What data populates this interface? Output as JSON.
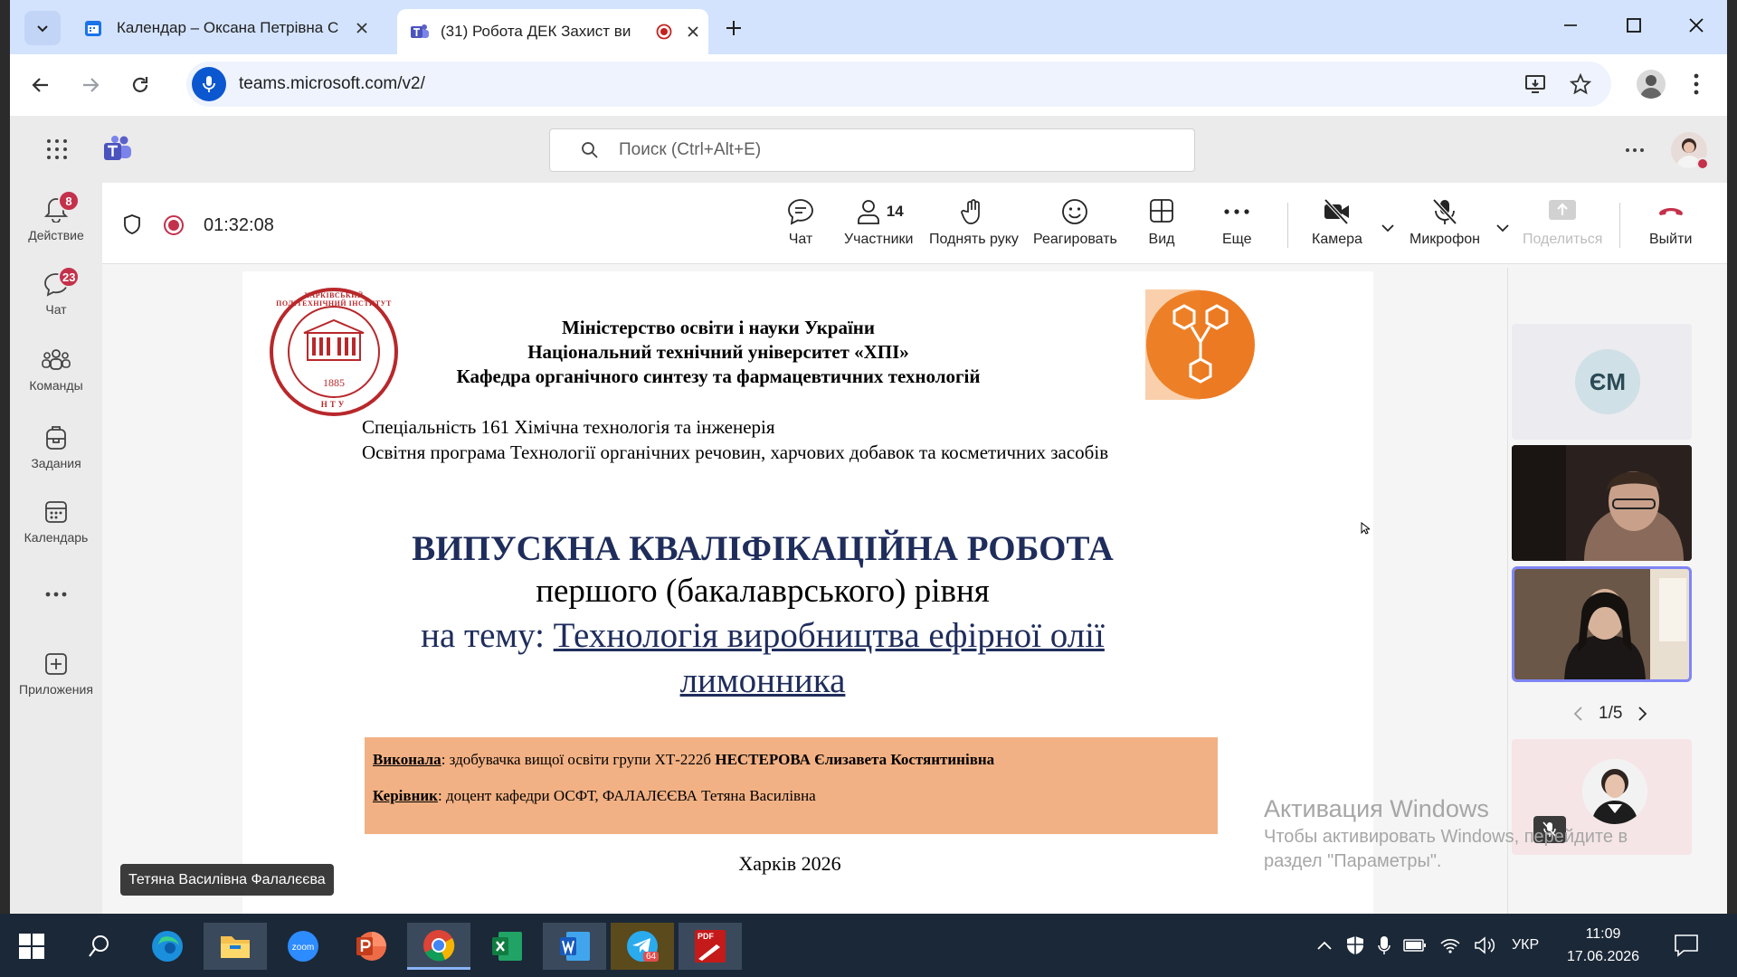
{
  "browser": {
    "tabs": [
      {
        "title": "Календар – Оксана Петрівна С"
      },
      {
        "title": "(31) Робота ДЕК Захист ви"
      }
    ],
    "url": "teams.microsoft.com/v2/"
  },
  "teams": {
    "search_placeholder": "Поиск (Ctrl+Alt+E)",
    "rail": [
      {
        "label": "Действие",
        "badge": "8"
      },
      {
        "label": "Чат",
        "badge": "23"
      },
      {
        "label": "Команды"
      },
      {
        "label": "Задания"
      },
      {
        "label": "Календарь"
      },
      {
        "label": "Приложения"
      }
    ]
  },
  "meeting": {
    "timer": "01:32:08",
    "participants_count": "14",
    "toolbar": {
      "chat": "Чат",
      "participants": "Участники",
      "raise_hand": "Поднять руку",
      "react": "Реагировать",
      "view": "Вид",
      "more": "Еще",
      "camera": "Камера",
      "mic": "Микрофон",
      "share": "Поделиться",
      "leave": "Выйти"
    },
    "presenter_name": "Тетяна Василівна Фалалєєва",
    "pager": "1/5",
    "participant_initials": "ЄМ"
  },
  "slide": {
    "logo_text_top": "ХАРКІВСЬКИЙ ПОЛІТЕХНІЧНИЙ ІНСТИТУТ",
    "logo_year": "1885",
    "logo_text_bottom": "НТУ",
    "header_line1": "Міністерство освіти і науки України",
    "header_line2": "Національний технічний університет «ХПІ»",
    "header_line3": "Кафедра органічного синтезу та фармацевтичних технологій",
    "specialty": "Спеціальність 161 Хімічна технологія та інженерія",
    "program": "Освітня програма Технології органічних речовин, харчових добавок та косметичних засобів",
    "title": "ВИПУСКНА КВАЛІФІКАЦІЙНА РОБОТА",
    "level": "першого (бакалаврського) рівня",
    "topic_prefix": "на тему: ",
    "topic_line1": "Технологія виробництва ефірної олії",
    "topic_line2": "лимонника",
    "author_label": "Виконала",
    "author_text": ": здобувачка вищої освіти групи ХТ-222б ",
    "author_name": "НЕСТЕРОВА Єлизавета Костянтинівна",
    "advisor_label": "Керівник",
    "advisor_text": ": доцент кафедри ОСФТ,  ФАЛАЛЄЄВА Тетяна Василівна",
    "city_year": "Харків 2026",
    "colors": {
      "title": "#1f2d5c",
      "box": "#f2b184",
      "logo_red": "#b8282b",
      "logo_orange": "#ec7a22"
    }
  },
  "activation": {
    "title": "Активация Windows",
    "line1": "Чтобы активировать Windows, перейдите в",
    "line2": "раздел \"Параметры\"."
  },
  "taskbar": {
    "language": "УКР",
    "time": "11:09",
    "date": "17.06.2026",
    "telegram_badge": "64",
    "pdf_label": "PDF"
  }
}
